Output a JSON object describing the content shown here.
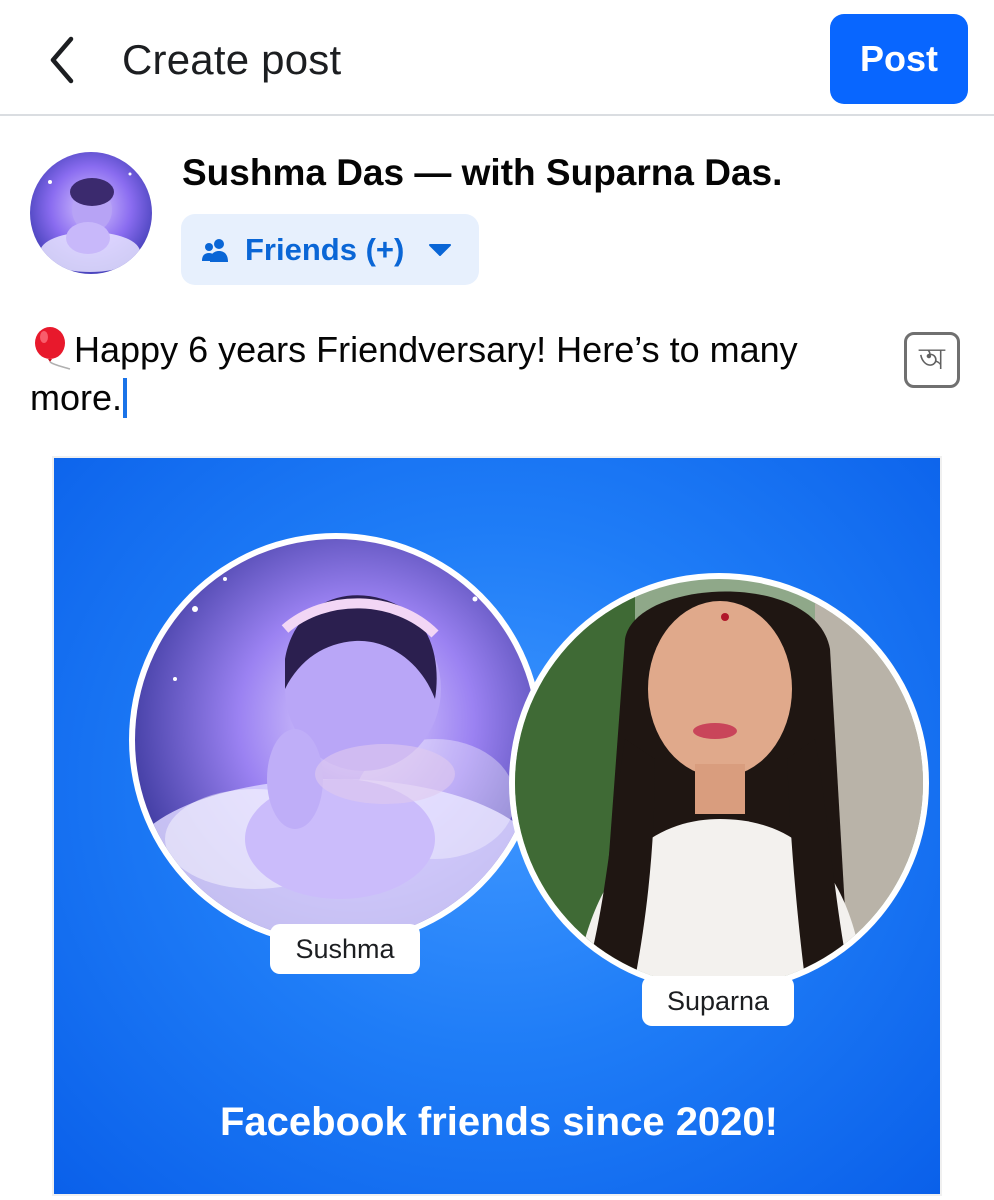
{
  "header": {
    "title": "Create post",
    "post_label": "Post"
  },
  "composer": {
    "author_line": "Sushma Das — with Suparna Das.",
    "audience_label": "Friends (+)",
    "text": "Happy 6 years Friendversary! Here’s to many more.",
    "translit_glyph": "অ"
  },
  "card": {
    "left_name": "Sushma",
    "right_name": "Suparna",
    "caption": "Facebook friends since 2020!"
  },
  "colors": {
    "accent": "#0866ff",
    "card_blue": "#1f7df7",
    "audience_bg": "#e7f0fd"
  }
}
